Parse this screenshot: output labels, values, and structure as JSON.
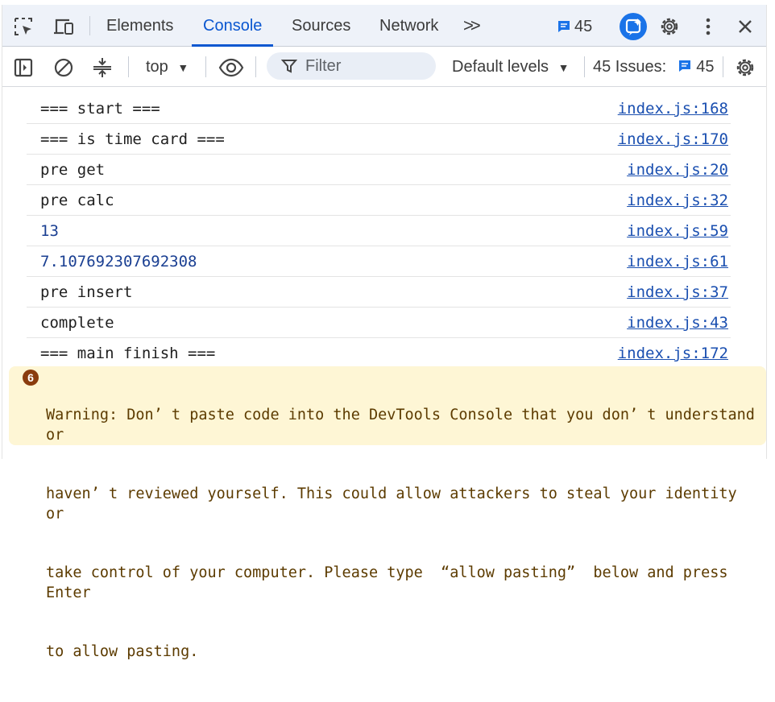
{
  "tabs": [
    {
      "label": "Elements",
      "active": false
    },
    {
      "label": "Console",
      "active": true
    },
    {
      "label": "Sources",
      "active": false
    },
    {
      "label": "Network",
      "active": false
    }
  ],
  "toolbar": {
    "inspect_icon": "element-picker-icon",
    "device_icon": "device-toolbar-icon",
    "more_tabs_label": ">>",
    "issues_count": "45",
    "ai_icon": "ai-assistant-icon",
    "settings_icon": "gear-icon",
    "menu_icon": "kebab-menu-icon",
    "close_icon": "close-icon"
  },
  "console_toolbar": {
    "sidebar_icon": "sidebar-toggle-icon",
    "clear_icon": "clear-console-icon",
    "collapse_icon": "collapse-icon",
    "context": "top",
    "eye_icon": "live-expression-icon",
    "filter_placeholder": "Filter",
    "levels": "Default levels",
    "issues_label": "45 Issues:",
    "issues_count": "45",
    "settings_icon": "gear-icon"
  },
  "messages": [
    {
      "text": "=== start ===",
      "source": "index.js:168",
      "numeric": false
    },
    {
      "text": "=== is time card ===",
      "source": "index.js:170",
      "numeric": false
    },
    {
      "text": "pre get",
      "source": "index.js:20",
      "numeric": false
    },
    {
      "text": "pre calc",
      "source": "index.js:32",
      "numeric": false
    },
    {
      "text": "13",
      "source": "index.js:59",
      "numeric": true
    },
    {
      "text": "7.107692307692308",
      "source": "index.js:61",
      "numeric": true
    },
    {
      "text": "pre insert",
      "source": "index.js:37",
      "numeric": false
    },
    {
      "text": "complete",
      "source": "index.js:43",
      "numeric": false
    },
    {
      "text": "=== main finish ===",
      "source": "index.js:172",
      "numeric": false
    }
  ],
  "warning": {
    "count": "6",
    "lines": [
      "Warning: Don’ t paste code into the DevTools Console that you don’ t understand or",
      "haven’ t reviewed yourself. This could allow attackers to steal your identity or",
      "take control of your computer. Please type  “allow pasting”  below and press Enter",
      "to allow pasting."
    ]
  },
  "colors": {
    "accent": "#0b57d0",
    "link": "#1a4fb0",
    "warning_bg": "#fef6d5",
    "warning_text": "#5c3b00",
    "number": "#1a3f92"
  }
}
